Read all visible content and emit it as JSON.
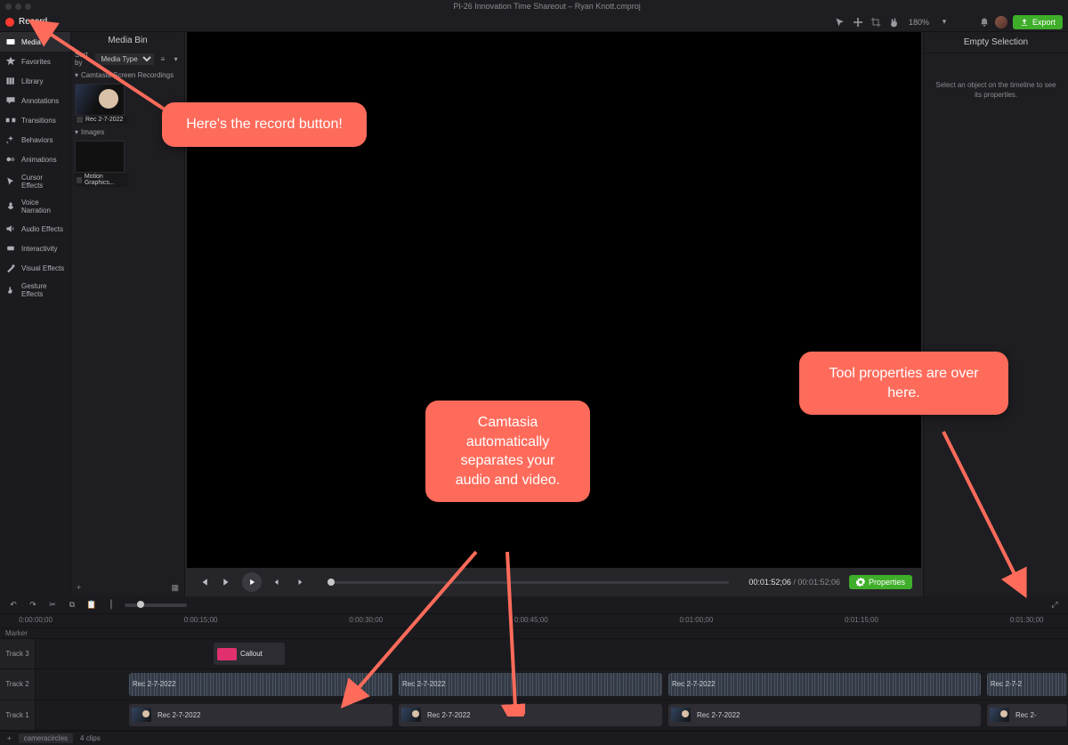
{
  "titlebar": {
    "document_title": "PI-26 Innovation Time Shareout – Ryan Knott.cmproj"
  },
  "toolbar": {
    "record_label": "Record",
    "zoom": "180%",
    "export_label": "Export"
  },
  "left_rail": {
    "items": [
      {
        "label": "Media"
      },
      {
        "label": "Favorites"
      },
      {
        "label": "Library"
      },
      {
        "label": "Annotations"
      },
      {
        "label": "Transitions"
      },
      {
        "label": "Behaviors"
      },
      {
        "label": "Animations"
      },
      {
        "label": "Cursor Effects"
      },
      {
        "label": "Voice Narration"
      },
      {
        "label": "Audio Effects"
      },
      {
        "label": "Interactivity"
      },
      {
        "label": "Visual Effects"
      },
      {
        "label": "Gesture Effects"
      }
    ]
  },
  "media_bin": {
    "header": "Media Bin",
    "sort_by_label": "Sort by",
    "sort_by_value": "Media Type",
    "sections": {
      "recordings": {
        "title": "Camtasia Screen Recordings",
        "items": [
          {
            "label": "Rec 2-7-2022"
          }
        ]
      },
      "images": {
        "title": "Images",
        "items": [
          {
            "label": "Motion Graphics..."
          }
        ]
      }
    }
  },
  "properties_panel": {
    "header": "Empty Selection",
    "message": "Select an object on the timeline to see its properties."
  },
  "playback": {
    "current_time": "00:01:52;06",
    "total_time": "00:01:52;06",
    "properties_button": "Properties"
  },
  "timeline": {
    "marker_label": "Marker",
    "ruler": [
      "0:00:00;00",
      "0:00:15;00",
      "0:00:30;00",
      "0:00:45;00",
      "0:01:00;00",
      "0:01:15;00",
      "0:01:30;00"
    ],
    "tracks": {
      "track3": {
        "label": "Track 3",
        "callout_label": "Callout"
      },
      "track2": {
        "label": "Track 2",
        "clips": [
          {
            "label": "Rec 2-7-2022"
          },
          {
            "label": "Rec 2-7-2022"
          },
          {
            "label": "Rec 2-7-2022"
          },
          {
            "label": "Rec 2-7-2"
          }
        ]
      },
      "track1": {
        "label": "Track 1",
        "clips": [
          {
            "label": "Rec 2-7-2022"
          },
          {
            "label": "Rec 2-7-2022"
          },
          {
            "label": "Rec 2-7-2022"
          },
          {
            "label": "Rec 2-"
          }
        ]
      }
    },
    "footer": {
      "group": "cameracircles",
      "clip_count": "4 clips"
    }
  },
  "annotations": {
    "callout1": "Here's the record button!",
    "callout2": "Camtasia automatically separates your audio and video.",
    "callout3": "Tool properties are over here."
  }
}
